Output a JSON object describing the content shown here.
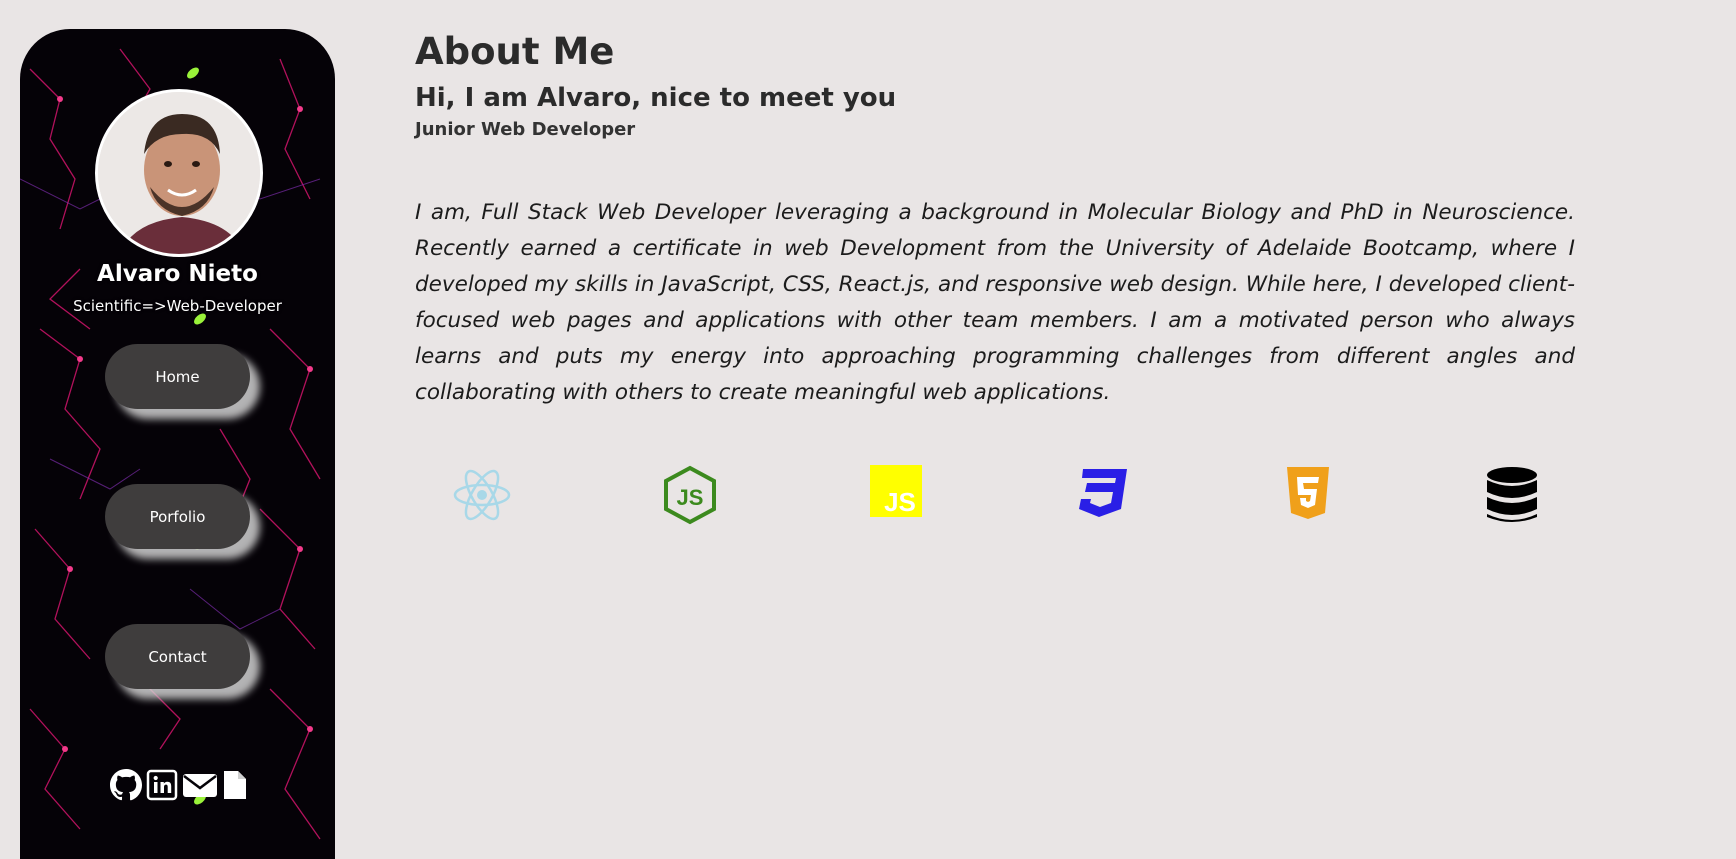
{
  "sidebar": {
    "name": "Alvaro Nieto",
    "tagline": "Scientific=>Web-Developer",
    "nav": [
      {
        "label": "Home"
      },
      {
        "label": "Porfolio"
      },
      {
        "label": "Contact"
      }
    ],
    "socials": [
      "github-icon",
      "linkedin-icon",
      "email-icon",
      "document-icon"
    ]
  },
  "main": {
    "title": "About Me",
    "greeting": "Hi, I am Alvaro, nice to meet you",
    "role": "Junior Web Developer",
    "bio": "I am, Full Stack Web Developer leveraging a background in Molecular Biology and PhD in Neuroscience. Recently earned a certificate in web Development from the University of Adelaide Bootcamp, where I developed my skills in JavaScript, CSS, React.js, and responsive web design. While here, I developed client-focused web pages and applications with other team members. I am a motivated person who always learns and puts my energy into approaching programming challenges from different angles and collaborating with others to create meaningful web applications."
  },
  "tech_icons": [
    "react-icon",
    "nodejs-icon",
    "javascript-icon",
    "css3-icon",
    "html5-icon",
    "database-icon"
  ],
  "colors": {
    "page_bg": "#e9e5e5",
    "sidebar_bg": "#050207",
    "button_bg": "#3f3d3d",
    "react": "#a8d8e8",
    "node": "#3c8a1e",
    "js": "#ffff00",
    "css": "#2a1fe6",
    "html": "#f0a01a"
  }
}
